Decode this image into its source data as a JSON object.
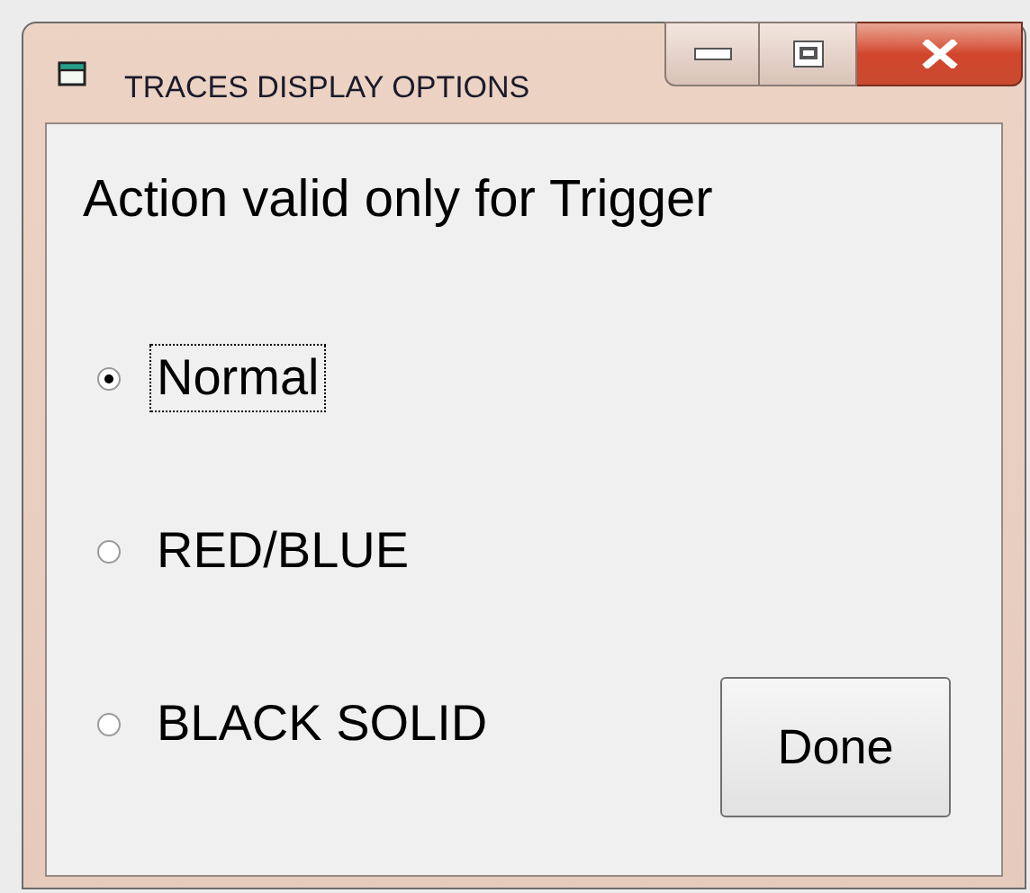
{
  "window": {
    "title": "TRACES DISPLAY OPTIONS"
  },
  "message": "Action valid only for Trigger",
  "options": [
    {
      "label": "Normal",
      "selected": true,
      "focused": true
    },
    {
      "label": "RED/BLUE",
      "selected": false,
      "focused": false
    },
    {
      "label": "BLACK SOLID",
      "selected": false,
      "focused": false
    }
  ],
  "button": "Done"
}
